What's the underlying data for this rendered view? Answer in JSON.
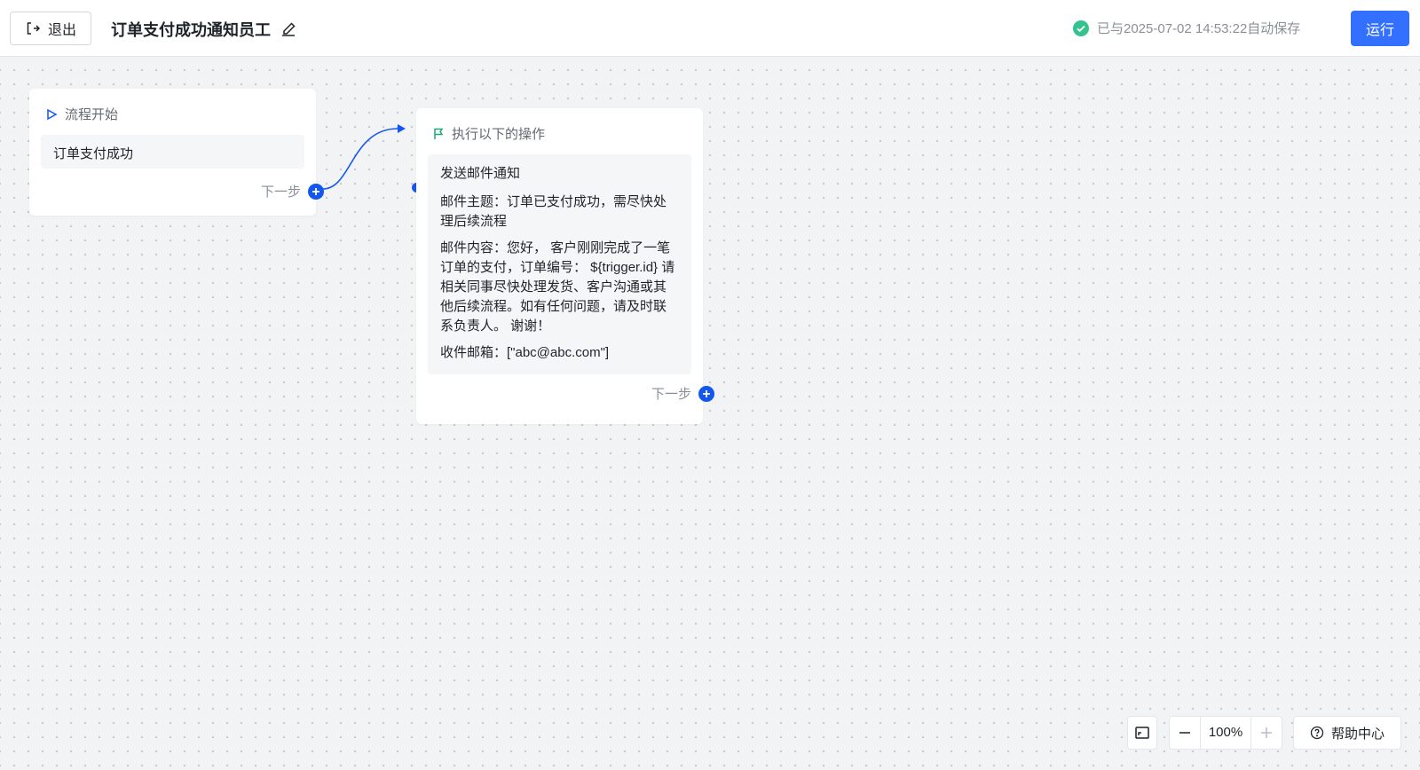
{
  "topbar": {
    "exit_label": "退出",
    "title": "订单支付成功通知员工",
    "save_status": "已与2025-07-02 14:53:22自动保存",
    "run_label": "运行"
  },
  "nodes": {
    "start": {
      "header": "流程开始",
      "trigger": "订单支付成功",
      "next_label": "下一步"
    },
    "action": {
      "header": "执行以下的操作",
      "title": "发送邮件通知",
      "subject": "邮件主题：订单已支付成功，需尽快处理后续流程",
      "content": "邮件内容：您好， 客户刚刚完成了一笔订单的支付，订单编号： ${trigger.id} 请相关同事尽快处理发货、客户沟通或其他后续流程。如有任何问题，请及时联系负责人。 谢谢！",
      "recipients": "收件邮箱：[\"abc@abc.com\"]",
      "next_label": "下一步"
    }
  },
  "footer": {
    "zoom_value": "100%",
    "help_label": "帮助中心"
  },
  "colors": {
    "accent": "#3370ff",
    "connector": "#1456f0",
    "success": "#34c38f"
  }
}
